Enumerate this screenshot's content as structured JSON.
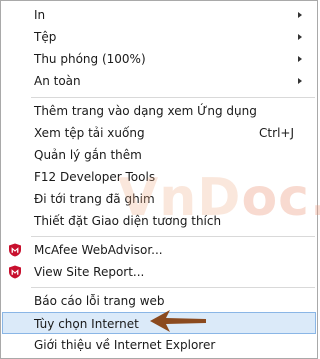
{
  "menu": {
    "items": [
      {
        "label": "In",
        "has_submenu": true
      },
      {
        "label": "Tệp",
        "has_submenu": true
      },
      {
        "label": "Thu phóng (100%)",
        "has_submenu": true
      },
      {
        "label": "An toàn",
        "has_submenu": true
      },
      {
        "label": "Thêm trang vào dạng xem Ứng dụng"
      },
      {
        "label": "Xem tệp tải xuống",
        "shortcut": "Ctrl+J"
      },
      {
        "label": "Quản lý gắn thêm"
      },
      {
        "label": "F12 Developer Tools"
      },
      {
        "label": "Đi tới trang đã ghim"
      },
      {
        "label": "Thiết đặt Giao diện tương thích"
      },
      {
        "label": "McAfee WebAdvisor...",
        "icon": "mcafee-icon"
      },
      {
        "label": "View Site Report...",
        "icon": "mcafee-icon"
      },
      {
        "label": "Báo cáo lỗi trang web"
      },
      {
        "label": "Tùy chọn Internet",
        "highlighted": true
      },
      {
        "label": "Giới thiệu về Internet Explorer"
      }
    ]
  },
  "watermark": {
    "text_part1": "VnD",
    "text_part2": "oc.com"
  },
  "colors": {
    "highlight_bg": "#dbeaf9",
    "highlight_border": "#8ab6e6",
    "mcafee_red": "#c8102e",
    "pointer_arrow": "#8b4a1f"
  }
}
